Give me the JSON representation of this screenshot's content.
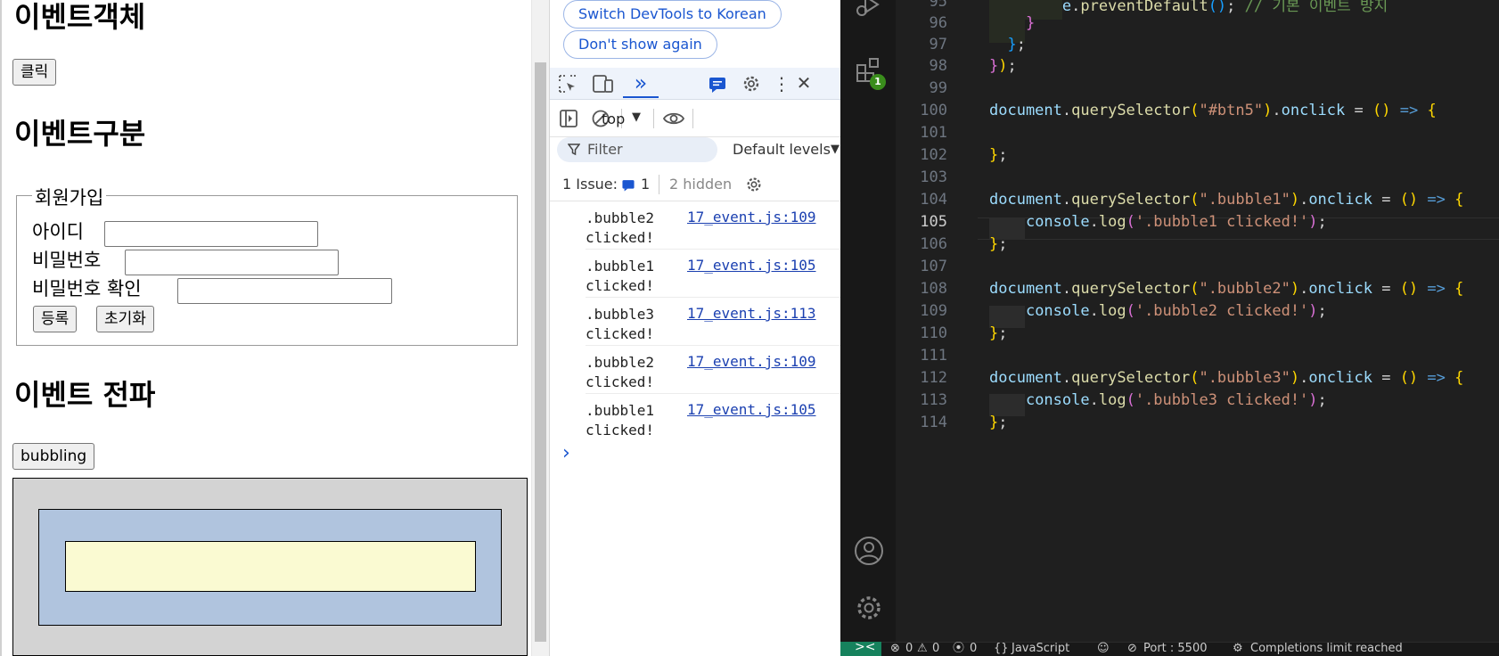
{
  "page": {
    "headings": {
      "event_object": "이벤트객체",
      "event_types": "이벤트구분",
      "propagation": "이벤트 전파"
    },
    "click_button": "클릭",
    "form": {
      "legend": "회원가입",
      "id_label": "아이디",
      "pw_label": "비밀번호",
      "pw_confirm_label": "비밀번호 확인",
      "submit_label": "등록",
      "reset_label": "초기화"
    },
    "bubbling_button": "bubbling",
    "bubble_colors": {
      "outer": "#d3d3d3",
      "middle": "#b0c4de",
      "inner": "#fafad2"
    }
  },
  "devtools": {
    "switch_language": "Switch DevTools to Korean",
    "dont_show": "Don't show again",
    "context": "top",
    "filter_placeholder": "Filter",
    "levels": "Default levels",
    "issues_label": "1 Issue:",
    "issues_count": "1",
    "hidden": "2 hidden",
    "messages": [
      {
        "text": ".bubble2\nclicked!",
        "source": "17_event.js:109"
      },
      {
        "text": ".bubble1\nclicked!",
        "source": "17_event.js:105"
      },
      {
        "text": ".bubble3\nclicked!",
        "source": "17_event.js:113"
      },
      {
        "text": ".bubble2\nclicked!",
        "source": "17_event.js:109"
      },
      {
        "text": ".bubble1\nclicked!",
        "source": "17_event.js:105"
      }
    ],
    "prompt": "›"
  },
  "vscode": {
    "extensions_badge": "1",
    "line_numbers": [
      "95",
      "96",
      "97",
      "98",
      "99",
      "100",
      "101",
      "102",
      "103",
      "104",
      "105",
      "106",
      "107",
      "108",
      "109",
      "110",
      "111",
      "112",
      "113",
      "114"
    ],
    "current_line": "105",
    "status": {
      "errors": "0",
      "warnings": "0",
      "ports": "0",
      "language": "JavaScript",
      "port": "Port : 5500",
      "completions": "Completions limit reached"
    }
  }
}
